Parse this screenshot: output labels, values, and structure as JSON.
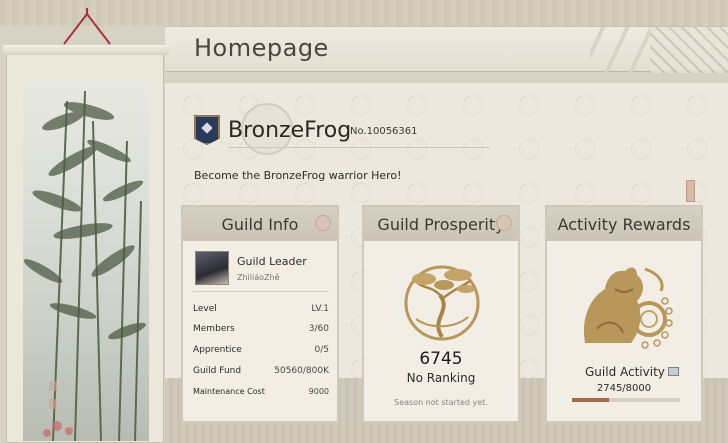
{
  "header": {
    "title": "Homepage"
  },
  "guild": {
    "name": "BronzeFrog",
    "number": "No.10056361",
    "motto": "Become the BronzeFrog warrior Hero!"
  },
  "guild_info": {
    "title": "Guild Info",
    "leader_label": "Guild Leader",
    "leader_name": "ZhìliáoZhě",
    "rows": [
      {
        "key": "Level",
        "value": "LV.1"
      },
      {
        "key": "Members",
        "value": "3/60"
      },
      {
        "key": "Apprentice",
        "value": "0/5"
      },
      {
        "key": "Guild Fund",
        "value": "50560/800K"
      },
      {
        "key": "Maintenance Cost",
        "value": "9000"
      }
    ]
  },
  "guild_prosperity": {
    "title": "Guild Prosperity",
    "value": "6745",
    "ranking": "No Ranking",
    "note": "Season not started yet."
  },
  "activity_rewards": {
    "title": "Activity Rewards",
    "label": "Guild Activity",
    "value": "2745/8000",
    "progress": 0.343
  },
  "colors": {
    "background": "#d8d2c4",
    "panel": "#ece8de",
    "card": "#f2eee5",
    "emblem": "#2c3a5a",
    "progress_fill": "#a36a4a"
  }
}
